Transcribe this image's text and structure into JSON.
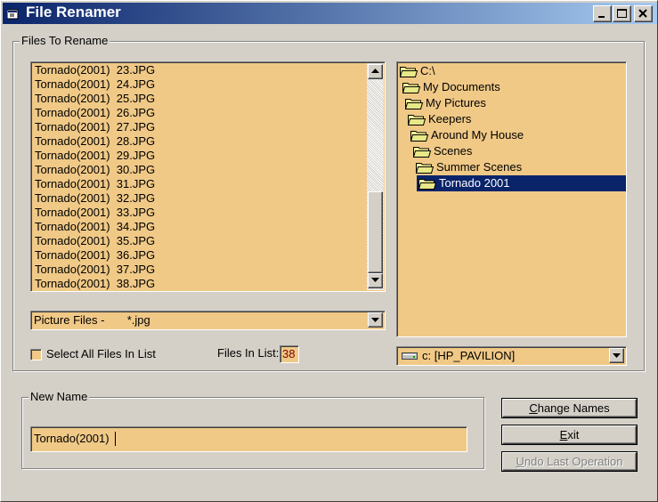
{
  "window": {
    "title": "File Renamer",
    "colors": {
      "face": "#d4d0c8",
      "field": "#f0c987",
      "selection": "#0a246a",
      "titlebar": "#0a246a"
    }
  },
  "files_group": {
    "label": "Files To Rename",
    "file_list": [
      "Tornado(2001)  23.JPG",
      "Tornado(2001)  24.JPG",
      "Tornado(2001)  25.JPG",
      "Tornado(2001)  26.JPG",
      "Tornado(2001)  27.JPG",
      "Tornado(2001)  28.JPG",
      "Tornado(2001)  29.JPG",
      "Tornado(2001)  30.JPG",
      "Tornado(2001)  31.JPG",
      "Tornado(2001)  32.JPG",
      "Tornado(2001)  33.JPG",
      "Tornado(2001)  34.JPG",
      "Tornado(2001)  35.JPG",
      "Tornado(2001)  36.JPG",
      "Tornado(2001)  37.JPG",
      "Tornado(2001)  38.JPG"
    ],
    "file_type_filter": "Picture Files -       *.jpg",
    "select_all_label": "Select All Files In List",
    "select_all_checked": false,
    "files_in_list_label": "Files In List:",
    "files_in_list_count": "38",
    "directories": [
      {
        "label": "C:\\",
        "selected": false
      },
      {
        "label": "My Documents",
        "selected": false
      },
      {
        "label": "My Pictures",
        "selected": false
      },
      {
        "label": "Keepers",
        "selected": false
      },
      {
        "label": "Around My House",
        "selected": false
      },
      {
        "label": "Scenes",
        "selected": false
      },
      {
        "label": "Summer Scenes",
        "selected": false
      },
      {
        "label": "Tornado 2001",
        "selected": true
      }
    ],
    "drive": "c: [HP_PAVILION]"
  },
  "new_name_group": {
    "label": "New Name",
    "value": "Tornado(2001) "
  },
  "buttons": {
    "change_names": {
      "prefix": "",
      "hotkey": "C",
      "rest": "hange Names",
      "enabled": true
    },
    "exit": {
      "prefix": "",
      "hotkey": "E",
      "rest": "xit",
      "enabled": true
    },
    "undo": {
      "prefix": "",
      "hotkey": "U",
      "rest": "ndo Last Operation",
      "enabled": false
    }
  },
  "icons": {
    "app": "app-window-icon",
    "minimize": "minimize-icon",
    "maximize": "maximize-icon",
    "close": "close-icon",
    "folder": "folder-icon",
    "drive": "hard-drive-icon",
    "scroll_up": "arrow-up-icon",
    "scroll_down": "arrow-down-icon",
    "dropdown": "arrow-down-icon"
  }
}
